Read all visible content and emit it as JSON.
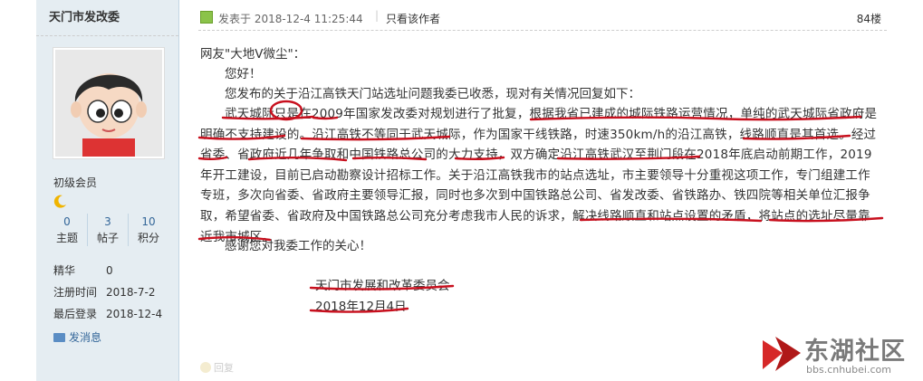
{
  "user": {
    "name": "天门市发改委",
    "rank": "初级会员",
    "stats": [
      {
        "value": "0",
        "label": "主题"
      },
      {
        "value": "3",
        "label": "帖子"
      },
      {
        "value": "10",
        "label": "积分"
      }
    ],
    "info": [
      {
        "key": "精华",
        "value": "0"
      },
      {
        "key": "注册时间",
        "value": "2018-7-2"
      },
      {
        "key": "最后登录",
        "value": "2018-12-4"
      }
    ],
    "send_message": "发消息"
  },
  "post": {
    "posted_at": "发表于 2018-12-4 11:25:44",
    "author_only": "只看该作者",
    "floor": "84楼",
    "lines": [
      "网友\"大地V微尘\"：",
      "您好！",
      "您发布的关于沿江高铁天门站选址问题我委已收悉，现对有关情况回复如下："
    ],
    "paragraph": [
      "武天城际只是在2009年国家发改委对规划进行了批复，根据我省已建成的城际铁路运营情况，单纯的武天城际省政府是",
      "明确不支持建设的。沿江高铁不等同于武天城际，作为国家干线铁路，时速350km/h的沿江高铁，线路顺直是其首选。经过",
      "省委、省政府近几年争取和中国铁路总公司的大力支持，双方确定沿江高铁武汉至荆门段在2018年底启动前期工作，2019",
      "年开工建设，目前已启动勘察设计招标工作。关于沿江高铁我市的站点选址，市主要领导十分重视这项工作，专门组建工作",
      "专班，多次向省委、省政府主要领导汇报，同时也多次到中国铁路总公司、省发改委、省铁路办、铁四院等相关单位汇报争",
      "取，希望省委、省政府及中国铁路总公司充分考虑我市人民的诉求，解决线路顺直和站点设置的矛盾，将站点的选址尽量靠",
      "近我市城区。"
    ],
    "closing": "感谢您对我委工作的关心！",
    "signature_org": "天门市发展和改革委员会",
    "signature_date": "2018年12月4日"
  },
  "reply_label": "回复",
  "watermark": {
    "name": "东湖社区",
    "url": "bbs.cnhubei.com"
  },
  "colors": {
    "sidebar_bg": "#e5edf2",
    "link": "#336699",
    "annotation": "#c8101e"
  }
}
